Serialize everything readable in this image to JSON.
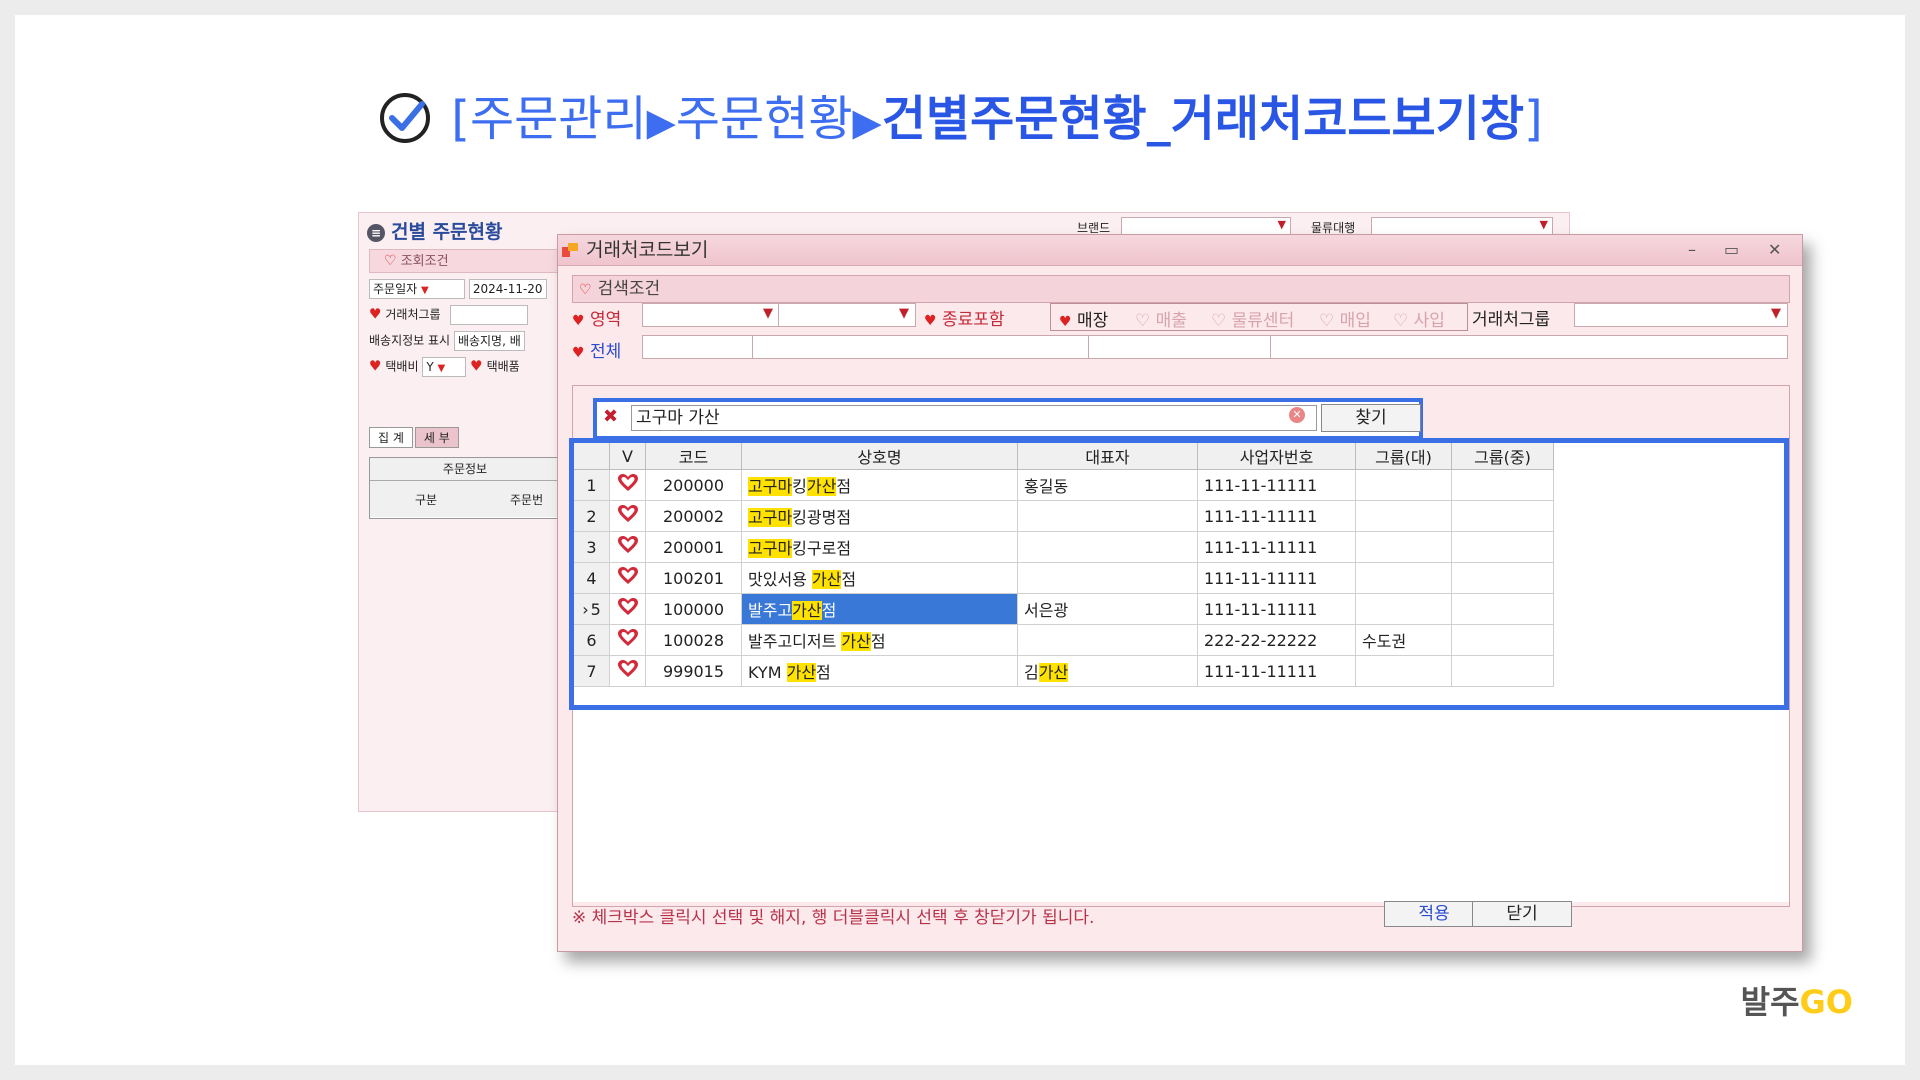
{
  "slide": {
    "title_prefix": "[주문관리",
    "title_mid": "주문현황",
    "title_bold": "건별주문현황_거래처코드보기창",
    "title_suffix": "]",
    "separator": "▶",
    "logo_a": "발주",
    "logo_b": "GO"
  },
  "bg_window": {
    "title": "건별 주문현황",
    "brand_label": "브랜드",
    "logistics_label": "물류대행",
    "condition_head": "조회조건",
    "order_date_label": "주문일자",
    "order_date_value": "2024-11-20",
    "client_group_label": "거래처그룹",
    "delivery_label": "배송지정보 표시",
    "delivery_value": "배송지명, 배",
    "shipping_fee_label": "택배비",
    "shipping_fee_value": "Y",
    "shipping_product_label": "택배품",
    "tab_total": "집 계",
    "tab_detail": "세 부",
    "order_info": "주문정보",
    "col_type": "구분",
    "col_order": "주문번"
  },
  "window": {
    "title": "거래처코드보기",
    "minimize": "–",
    "maximize": "▭",
    "close": "✕",
    "search_condition": "검색조건",
    "area_label": "영역",
    "all_label": "전체",
    "include_closed": "종료포함",
    "options": [
      "매장",
      "매출",
      "물류센터",
      "매입",
      "사입"
    ],
    "client_group": "거래처그룹",
    "search_value": "고구마 가산",
    "find_button": "찾기",
    "columns": [
      "",
      "V",
      "코드",
      "상호명",
      "대표자",
      "사업자번호",
      "그룹(대)",
      "그룹(중)"
    ],
    "rows": [
      {
        "no": "1",
        "code": "200000",
        "name": [
          [
            "고구마",
            "h"
          ],
          [
            "킹",
            ""
          ],
          [
            "가산",
            "h"
          ],
          [
            "점",
            ""
          ]
        ],
        "rep": [
          [
            "홍길동",
            ""
          ]
        ],
        "biz": "111-11-11111",
        "g1": "",
        "g2": ""
      },
      {
        "no": "2",
        "code": "200002",
        "name": [
          [
            "고구마",
            "h"
          ],
          [
            "킹광명점",
            ""
          ]
        ],
        "rep": [],
        "biz": "111-11-11111",
        "g1": "",
        "g2": ""
      },
      {
        "no": "3",
        "code": "200001",
        "name": [
          [
            "고구마",
            "h"
          ],
          [
            "킹구로점",
            ""
          ]
        ],
        "rep": [],
        "biz": "111-11-11111",
        "g1": "",
        "g2": ""
      },
      {
        "no": "4",
        "code": "100201",
        "name": [
          [
            "맛있서용 ",
            ""
          ],
          [
            "가산",
            "h"
          ],
          [
            "점",
            ""
          ]
        ],
        "rep": [],
        "biz": "111-11-11111",
        "g1": "",
        "g2": ""
      },
      {
        "no": "5",
        "code": "100000",
        "name": [
          [
            "발주고",
            ""
          ],
          [
            "가산",
            "h"
          ],
          [
            "점",
            ""
          ]
        ],
        "rep": [
          [
            "서은광",
            ""
          ]
        ],
        "biz": "111-11-11111",
        "g1": "",
        "g2": "",
        "selected": true
      },
      {
        "no": "6",
        "code": "100028",
        "name": [
          [
            "발주고디저트 ",
            ""
          ],
          [
            "가산",
            "h"
          ],
          [
            "점",
            ""
          ]
        ],
        "rep": [],
        "biz": "222-22-22222",
        "g1": "수도권",
        "g2": ""
      },
      {
        "no": "7",
        "code": "999015",
        "name": [
          [
            "KYM ",
            ""
          ],
          [
            "가산",
            "h"
          ],
          [
            "점",
            ""
          ]
        ],
        "rep": [
          [
            "김",
            ""
          ],
          [
            "가산",
            "h"
          ]
        ],
        "biz": "111-11-11111",
        "g1": "",
        "g2": ""
      }
    ],
    "footer_note": "※ 체크박스 클릭시 선택 및 해지, 행 더블클릭시 선택 후 창닫기가 됩니다.",
    "apply_button": "적용",
    "close_button": "닫기"
  },
  "colors": {
    "accent_blue": "#3a6fe6",
    "highlight": "#ffe200",
    "selection": "#3a78d8",
    "heart": "#d22a3a"
  }
}
